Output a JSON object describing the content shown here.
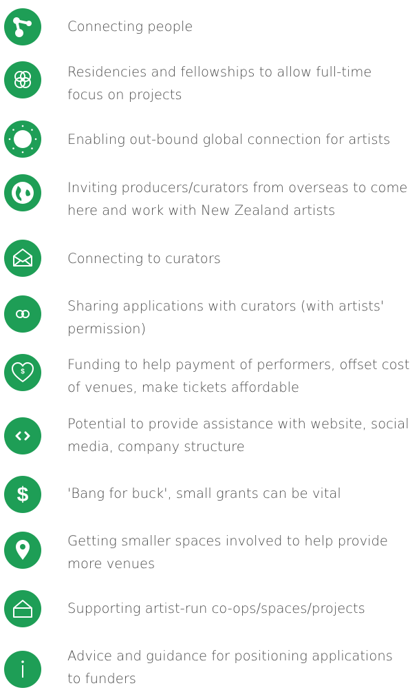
{
  "accent_color": "#1e9e56",
  "items": [
    {
      "label": "Connecting people",
      "icon": "network-nodes-icon"
    },
    {
      "label": "Residencies and fellowships to allow full-time focus on projects",
      "icon": "interlocking-rings-icon"
    },
    {
      "label": "Enabling out-bound global connection for artists",
      "icon": "sun-burst-icon"
    },
    {
      "label": "Inviting producers/curators from overseas to come here and work with New Zealand artists",
      "icon": "globe-icon"
    },
    {
      "label": "Connecting to curators",
      "icon": "envelope-icon"
    },
    {
      "label": "Sharing applications with curators (with artists' permission)",
      "icon": "linked-rings-icon"
    },
    {
      "label": "Funding to help payment of performers, offset cost of venues, make tickets affordable",
      "icon": "heart-dollar-icon"
    },
    {
      "label": "Potential to provide assistance with website, social media, company structure",
      "icon": "code-brackets-icon"
    },
    {
      "label": "'Bang for buck', small grants can be vital",
      "icon": "dollar-icon"
    },
    {
      "label": "Getting smaller spaces involved to help provide more venues",
      "icon": "map-pin-icon"
    },
    {
      "label": "Supporting artist-run co-ops/spaces/projects",
      "icon": "house-icon"
    },
    {
      "label": "Advice and guidance for positioning applications to funders",
      "icon": "info-icon"
    }
  ]
}
